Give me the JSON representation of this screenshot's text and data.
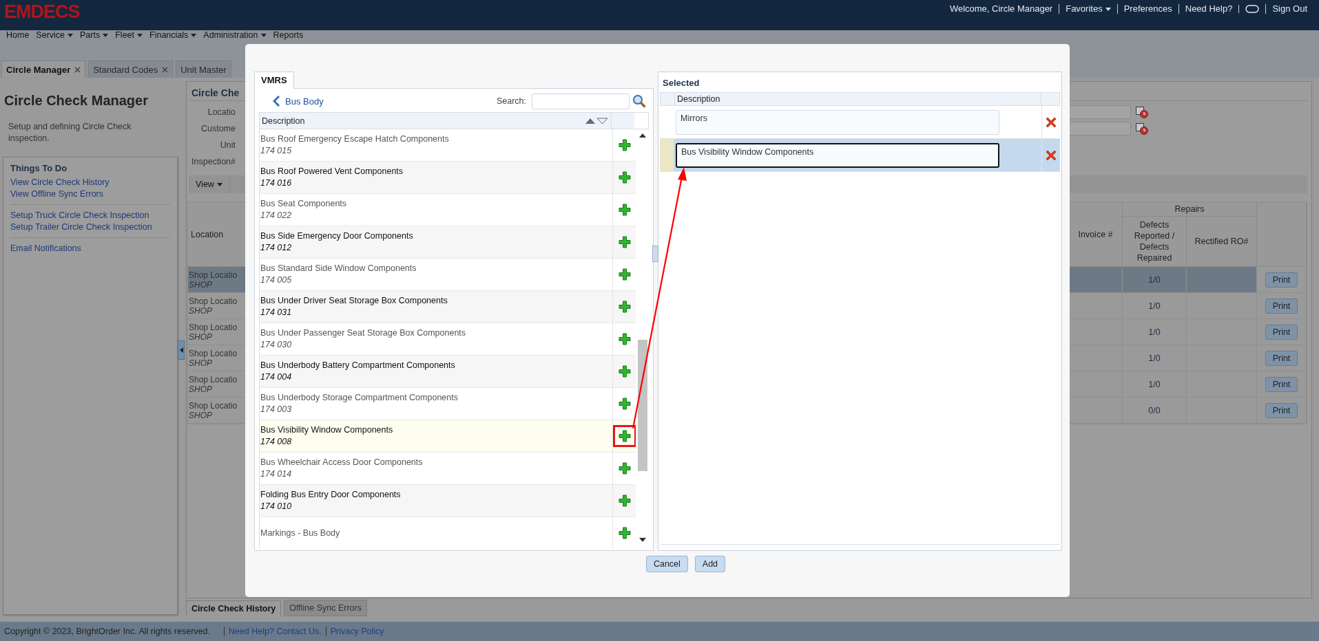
{
  "header": {
    "logo": "EMDECS",
    "items": [
      {
        "kind": "text",
        "label": "Welcome, Circle Manager"
      },
      {
        "kind": "menu",
        "label": "Favorites"
      },
      {
        "kind": "link",
        "label": "Preferences"
      },
      {
        "kind": "link",
        "label": "Need Help?"
      },
      {
        "kind": "toggle"
      },
      {
        "kind": "link",
        "label": "Sign Out"
      }
    ]
  },
  "menu": [
    {
      "label": "Home",
      "dropdown": false
    },
    {
      "label": "Service",
      "dropdown": true
    },
    {
      "label": "Parts",
      "dropdown": true
    },
    {
      "label": "Fleet",
      "dropdown": true
    },
    {
      "label": "Financials",
      "dropdown": true
    },
    {
      "label": "Administration",
      "dropdown": true
    },
    {
      "label": "Reports",
      "dropdown": false
    }
  ],
  "tabs": [
    {
      "label": "Circle Manager",
      "selected": true,
      "closable": true
    },
    {
      "label": "Standard Codes",
      "selected": false,
      "closable": true
    },
    {
      "label": "Unit Master",
      "selected": false,
      "closable": false
    }
  ],
  "sidebar": {
    "title": "Circle Check Manager",
    "description": "Setup and defining Circle Check inspection.",
    "section_title": "Things To Do",
    "link_groups": [
      [
        "View Circle Check History",
        "View Offline Sync Errors"
      ],
      [
        "Setup Truck Circle Check Inspection",
        "Setup Trailer Circle Check Inspection"
      ],
      [
        "Email Notifications"
      ]
    ]
  },
  "main": {
    "title": "Circle Che",
    "filters": [
      {
        "label": "Locatio",
        "kind": "date"
      },
      {
        "label": "Custome",
        "kind": "date"
      },
      {
        "label": "Unit",
        "kind": "plain"
      },
      {
        "label": "Inspection#",
        "kind": "plain"
      }
    ],
    "view_button": "View",
    "table": {
      "columns": {
        "location": "Location",
        "invoice": "Invoice #",
        "group": "Repairs",
        "defects": "Defects Reported / Defects Repaired",
        "rectified": "Rectified RO#"
      },
      "rows": [
        {
          "location": "Shop Locatio",
          "code": "SHOP",
          "defects": "1/0",
          "button": "Print",
          "selected": true
        },
        {
          "location": "Shop Locatio",
          "code": "SHOP",
          "defects": "1/0",
          "button": "Print",
          "selected": false
        },
        {
          "location": "Shop Locatio",
          "code": "SHOP",
          "defects": "1/0",
          "button": "Print",
          "selected": false
        },
        {
          "location": "Shop Locatio",
          "code": "SHOP",
          "defects": "1/0",
          "button": "Print",
          "selected": false
        },
        {
          "location": "Shop Locatio",
          "code": "SHOP",
          "defects": "1/0",
          "button": "Print",
          "selected": false
        },
        {
          "location": "Shop Locatio",
          "code": "SHOP",
          "defects": "0/0",
          "button": "Print",
          "selected": false
        }
      ]
    },
    "bottom_tabs": [
      {
        "label": "Circle Check History",
        "selected": true
      },
      {
        "label": "Offline Sync Errors",
        "selected": false
      }
    ]
  },
  "dialog": {
    "tab": "VMRS",
    "breadcrumb": "Bus Body",
    "search_label": "Search:",
    "column": "Description",
    "items": [
      {
        "name": "Bus Roof Emergency Escape Hatch Components",
        "code": "174 015",
        "selected": false
      },
      {
        "name": "Bus Roof Powered Vent Components",
        "code": "174 016",
        "selected": false
      },
      {
        "name": "Bus Seat Components",
        "code": "174 022",
        "selected": false
      },
      {
        "name": "Bus Side Emergency Door Components",
        "code": "174 012",
        "selected": false
      },
      {
        "name": "Bus Standard Side Window Components",
        "code": "174 005",
        "selected": false
      },
      {
        "name": "Bus Under Driver Seat Storage Box Components",
        "code": "174 031",
        "selected": false
      },
      {
        "name": "Bus Under Passenger Seat Storage Box Components",
        "code": "174 030",
        "selected": false
      },
      {
        "name": "Bus Underbody Battery Compartment Components",
        "code": "174 004",
        "selected": false
      },
      {
        "name": "Bus Underbody Storage Compartment Components",
        "code": "174 003",
        "selected": false
      },
      {
        "name": "Bus Visibility Window Components",
        "code": "174 008",
        "selected": true
      },
      {
        "name": "Bus Wheelchair Access Door Components",
        "code": "174 014",
        "selected": false
      },
      {
        "name": "Folding Bus Entry Door Components",
        "code": "174 010",
        "selected": false
      },
      {
        "name": "Markings - Bus Body",
        "selected": false
      }
    ],
    "selected_title": "Selected",
    "selected_column": "Description",
    "selected_items": [
      {
        "text": "Mirrors",
        "selected": false
      },
      {
        "text": "Bus Visibility Window Components",
        "selected": true
      }
    ],
    "buttons": [
      "Cancel",
      "Add"
    ]
  },
  "footer": {
    "copyright": "Copyright © 2023, BrightOrder Inc. All rights reserved.",
    "links": [
      "Need Help? Contact Us.",
      "Privacy Policy"
    ]
  }
}
